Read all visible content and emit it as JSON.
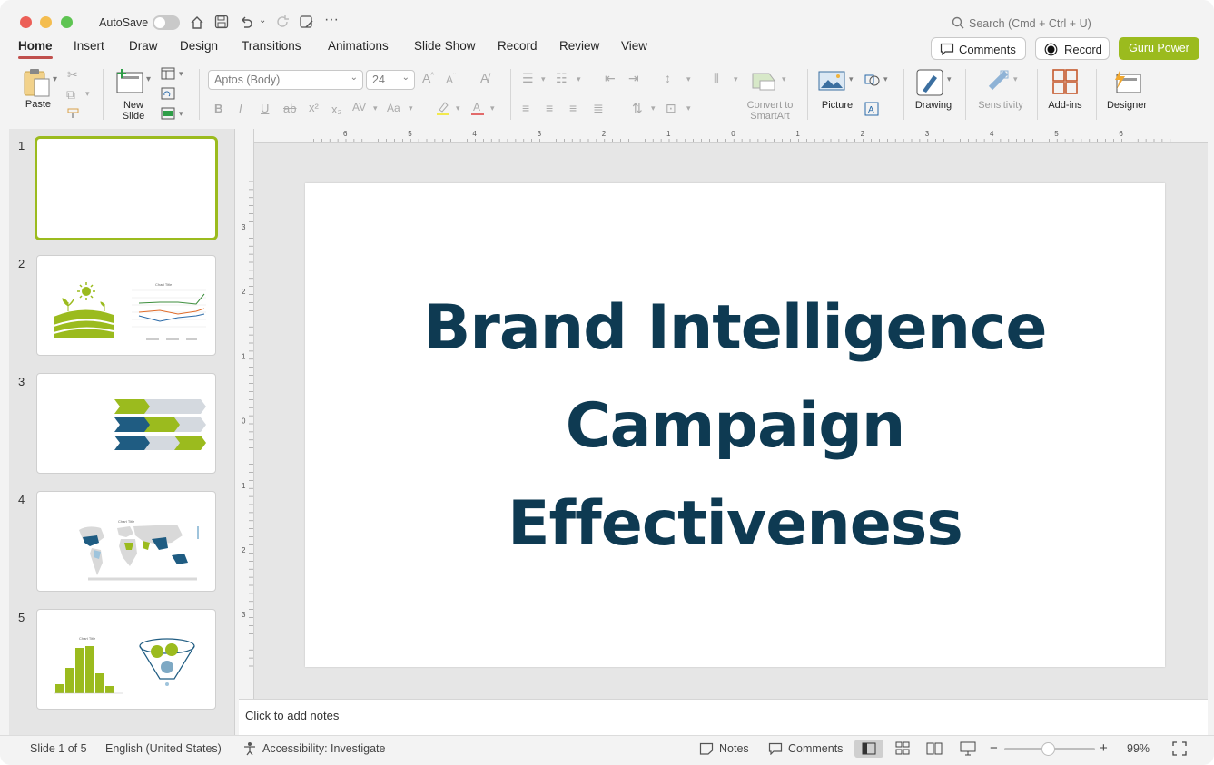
{
  "titlebar": {
    "autosave": "AutoSave",
    "search_placeholder": "Search (Cmd + Ctrl + U)"
  },
  "tabs": [
    "Home",
    "Insert",
    "Draw",
    "Design",
    "Transitions",
    "Animations",
    "Slide Show",
    "Record",
    "Review",
    "View"
  ],
  "actions": {
    "comments": "Comments",
    "record": "Record",
    "guru": "Guru Power"
  },
  "ribbon": {
    "paste": "Paste",
    "new_slide_1": "New",
    "new_slide_2": "Slide",
    "font_name": "Aptos (Body)",
    "font_size": "24",
    "convert_1": "Convert to",
    "convert_2": "SmartArt",
    "picture": "Picture",
    "drawing": "Drawing",
    "sensitivity": "Sensitivity",
    "addins": "Add-ins",
    "designer": "Designer"
  },
  "slides": [
    "1",
    "2",
    "3",
    "4",
    "5"
  ],
  "thumb2": {
    "chart_title": "Chart Title"
  },
  "thumb4": {
    "chart_title": "Chart Title"
  },
  "thumb5": {
    "chart_title": "Chart Title"
  },
  "ruler": {
    "top": [
      "6",
      "5",
      "4",
      "3",
      "2",
      "1",
      "0",
      "1",
      "2",
      "3",
      "4",
      "5",
      "6"
    ],
    "left": [
      "3",
      "2",
      "1",
      "0",
      "1",
      "2",
      "3"
    ]
  },
  "slide": {
    "title_lines": [
      "Brand Intelligence",
      "Campaign",
      "Effectiveness"
    ]
  },
  "notes": {
    "placeholder": "Click to add notes"
  },
  "status": {
    "slide_pos": "Slide 1 of 5",
    "language": "English (United States)",
    "accessibility": "Accessibility: Investigate",
    "notes": "Notes",
    "comments": "Comments",
    "zoom": "99%"
  },
  "colors": {
    "accent_green": "#9bbb1e",
    "title_navy": "#0e3a52",
    "ribbon_red": "#c0504d"
  }
}
